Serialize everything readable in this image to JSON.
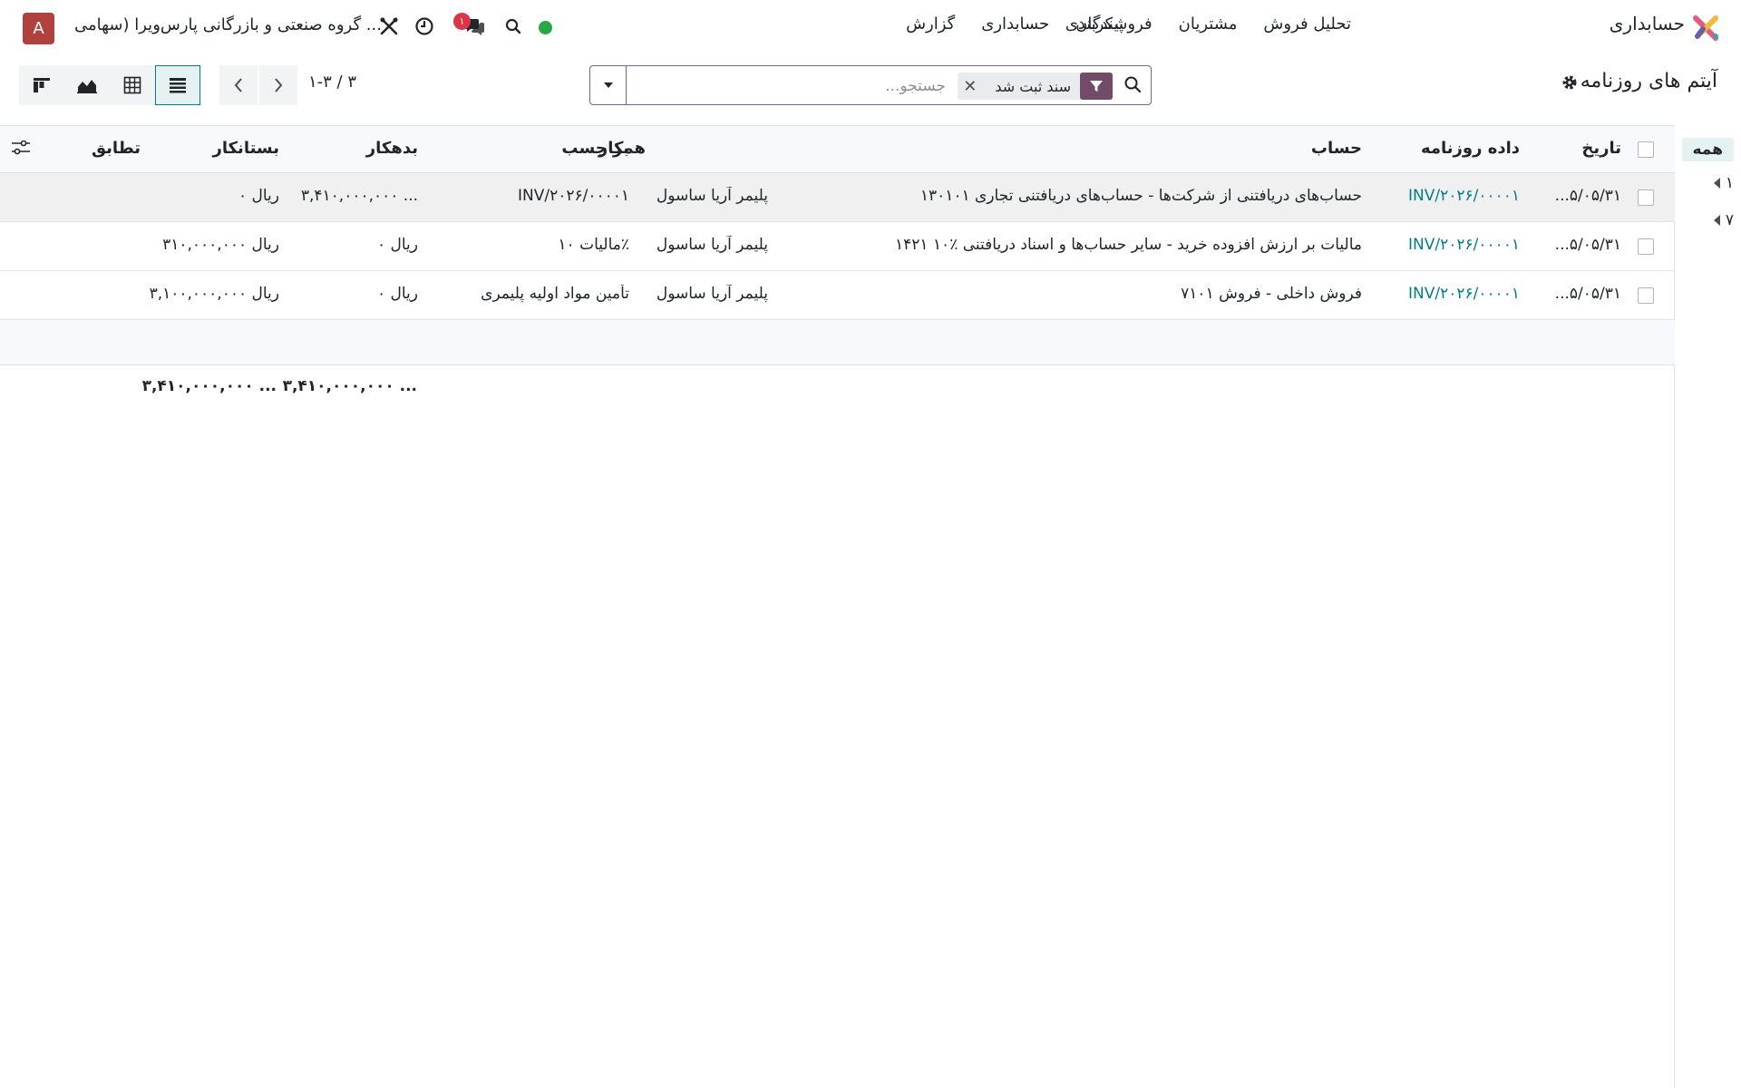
{
  "navbar": {
    "app_name": "حسابداری",
    "menu": [
      "تحلیل فروش",
      "مشتریان",
      "فروشندگان",
      "حسابداری",
      "گزارش"
    ],
    "menu_config": "پیکربندی",
    "company": "گروه صنعتی و بازرگانی پارس‌ویرا (سهامی ...",
    "avatar_letter": "A",
    "chat_badge": "۱",
    "status_color": "#28a745",
    "avatar_color": "#b0413e"
  },
  "control_panel": {
    "title": "آیتم های روزنامه",
    "search": {
      "placeholder": "جستجو...",
      "facet_label": "سند ثبت شد"
    },
    "pager": "۱-۳ / ۳",
    "views": [
      "list-view",
      "pivot-view",
      "graph-view",
      "kanban-view"
    ],
    "active_view": "list-view"
  },
  "table": {
    "columns": {
      "date": "تاریخ",
      "journal_entry": "داده روزنامه",
      "account": "حساب",
      "partner": "همکار",
      "label": "بر چسب",
      "debit": "بدهکار",
      "credit": "بستانکار",
      "matching": "تطابق"
    },
    "rows": [
      {
        "date": "...۵/۰۵/۳۱",
        "journal_entry": "INV/۲۰۲۶/۰۰۰۰۱",
        "account": "۱۳۰۱۰۱ حساب‌های دریافتنی از شرکت‌ها - حساب‌های دریافتنی تجاری",
        "partner": "پلیمر آریا ساسول",
        "label": "INV/۲۰۲۶/۰۰۰۰۱",
        "debit": "۳,۴۱۰,۰۰۰,۰۰۰ ...",
        "credit": "ریال ۰",
        "matching": ""
      },
      {
        "date": "...۵/۰۵/۳۱",
        "journal_entry": "INV/۲۰۲۶/۰۰۰۰۱",
        "account": "۱۴۲۱ ۱۰٪ مالیات بر ارزش افزوده خرید - سایر حساب‌ها و اسناد دریافتنی",
        "partner": "پلیمر آریا ساسول",
        "label": "مالیات ۱۰٪",
        "debit": "ریال ۰",
        "credit": "ریال ۳۱۰,۰۰۰,۰۰۰",
        "matching": ""
      },
      {
        "date": "...۵/۰۵/۳۱",
        "journal_entry": "INV/۲۰۲۶/۰۰۰۰۱",
        "account": "۷۱۰۱ فروش داخلی - فروش",
        "partner": "پلیمر آریا ساسول",
        "label": "تأمین مواد اولیه پلیمری",
        "debit": "ریال ۰",
        "credit": "ریال ۳,۱۰۰,۰۰۰,۰۰۰",
        "matching": ""
      }
    ],
    "totals": {
      "debit": "۳,۴۱۰,۰۰۰,۰۰۰ ...",
      "credit": "۳,۴۱۰,۰۰۰,۰۰۰ ..."
    }
  },
  "side_panel": {
    "items": [
      "همه",
      "۱",
      "۷"
    ]
  }
}
